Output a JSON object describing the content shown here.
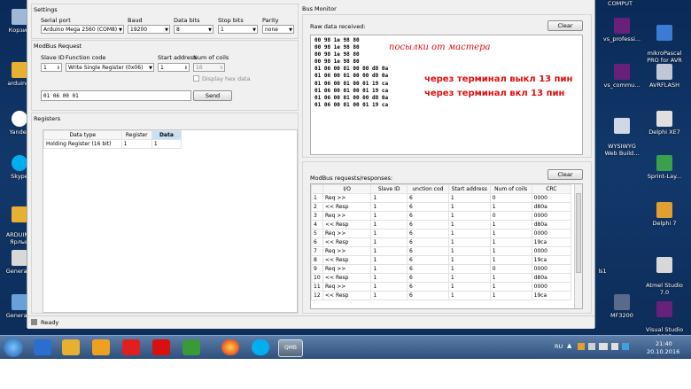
{
  "settings": {
    "title": "Settings",
    "serial_port_label": "Serial port",
    "serial_port_value": "Arduino Mega 2560 (COM8)",
    "baud_label": "Baud",
    "baud_value": "19200",
    "data_bits_label": "Data bits",
    "data_bits_value": "8",
    "stop_bits_label": "Stop bits",
    "stop_bits_value": "1",
    "parity_label": "Parity",
    "parity_value": "none"
  },
  "modbus_request": {
    "title": "ModBus Request",
    "slave_id_label": "Slave ID",
    "slave_id_value": "1",
    "function_code_label": "Function code",
    "function_code_value": "Write Single Register (0x06)",
    "start_address_label": "Start address",
    "start_address_value": "1",
    "num_coils_label": "Num of coils",
    "num_coils_value": "16",
    "display_hex_label": "Display hex data",
    "raw_request": "01  06  00 01",
    "send_label": "Send"
  },
  "registers": {
    "title": "Registers",
    "columns": [
      "Data type",
      "Register",
      "Data"
    ],
    "rows": [
      [
        "Holding Register (16 bit)",
        "1",
        "1"
      ]
    ]
  },
  "bus_monitor": {
    "title": "Bus Monitor",
    "raw_label": "Raw data received:",
    "clear_label": "Clear",
    "raw_lines": [
      "00 98 1e 98 80",
      "00 98 1e 98 80",
      "00 98 1e 98 80",
      "00 98 1e 98 80",
      "01 06 00 01 00 00 d8 0a",
      "01 06 00 01 00 00 d8 0a",
      "01 06 00 01 00 01 19 ca",
      "01 06 00 01 00 01 19 ca",
      "01 06 00 01 00 00 d8 0a",
      "01 06 00 01 00 01 19 ca"
    ],
    "annotation_master": "посылки от мастера",
    "annotation_off": "через терминал выкл 13 пин",
    "annotation_on": "через терминал вкл 13 пин",
    "req_label": "ModBus requests/responses:",
    "clear2_label": "Clear",
    "req_columns": [
      "I/O",
      "Slave ID",
      "unction cod",
      "Start address",
      "Num of coils",
      "CRC"
    ],
    "req_rows": [
      [
        "1",
        "Req >>",
        "1",
        "6",
        "1",
        "0",
        "0000"
      ],
      [
        "2",
        "<< Resp",
        "1",
        "6",
        "1",
        "1",
        "d80a"
      ],
      [
        "3",
        "Req >>",
        "1",
        "6",
        "1",
        "0",
        "0000"
      ],
      [
        "4",
        "<< Resp",
        "1",
        "6",
        "1",
        "1",
        "d80a"
      ],
      [
        "5",
        "Req >>",
        "1",
        "6",
        "1",
        "1",
        "0000"
      ],
      [
        "6",
        "<< Resp",
        "1",
        "6",
        "1",
        "1",
        "19ca"
      ],
      [
        "7",
        "Req >>",
        "1",
        "6",
        "1",
        "1",
        "0000"
      ],
      [
        "8",
        "<< Resp",
        "1",
        "6",
        "1",
        "1",
        "19ca"
      ],
      [
        "9",
        "Req >>",
        "1",
        "6",
        "1",
        "0",
        "0000"
      ],
      [
        "10",
        "<< Resp",
        "1",
        "6",
        "1",
        "1",
        "d80a"
      ],
      [
        "11",
        "Req >>",
        "1",
        "6",
        "1",
        "1",
        "0000"
      ],
      [
        "12",
        "<< Resp",
        "1",
        "6",
        "1",
        "1",
        "19ca"
      ]
    ]
  },
  "status": {
    "text": "Ready"
  },
  "desktop_left": [
    "Корзин",
    "arduino-",
    "Yandex",
    "Skype",
    "ARDUINO\nЯрлык",
    "GeneralH",
    "GeneralH"
  ],
  "desktop_right": [
    "COMPUT",
    "vs_professi...",
    "mikroPascal\nPRO for AVR",
    "vs_commu...",
    "AVRFLASH",
    "WYSIWYG\nWeb Build...",
    "Delphi XE7",
    "Sprint-Lay...",
    "Delphi 7",
    "Atmel Studio\n7.0",
    "ls1",
    "MF3200",
    "Visual Studio\n2015"
  ],
  "taskbar": {
    "lang": "RU",
    "time": "21:40",
    "date": "20.10.2016",
    "qmb_label": "QMB"
  },
  "colors": {
    "annotation": "#e01010",
    "selected_header": "#c8e0f4"
  }
}
